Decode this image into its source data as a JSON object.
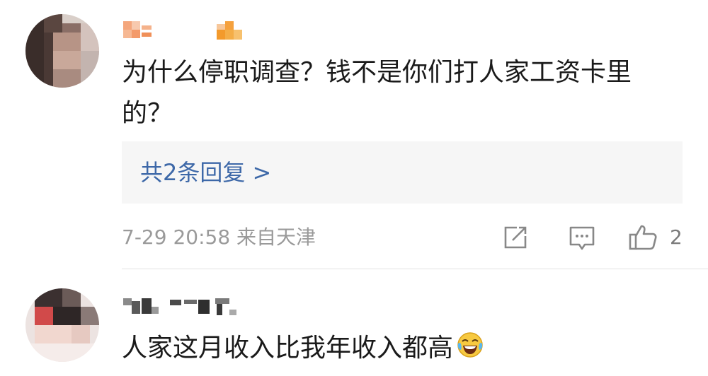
{
  "comments": [
    {
      "text": "为什么停职调查？钱不是你们打人家工资卡里的？",
      "reply_link": "共2条回复 >",
      "meta": "7-29 20:58 来自天津",
      "like_count": "2"
    },
    {
      "text": "人家这月收入比我年收入都高",
      "emoji": "laughing-crying-emoji"
    }
  ],
  "icons": {
    "share": "share-icon",
    "comment": "comment-icon",
    "like": "thumbs-up-icon"
  },
  "colors": {
    "link": "#3d68a8",
    "meta": "#9a9a9a",
    "text": "#1a1a1a",
    "reply_bg": "#f6f6f6"
  }
}
